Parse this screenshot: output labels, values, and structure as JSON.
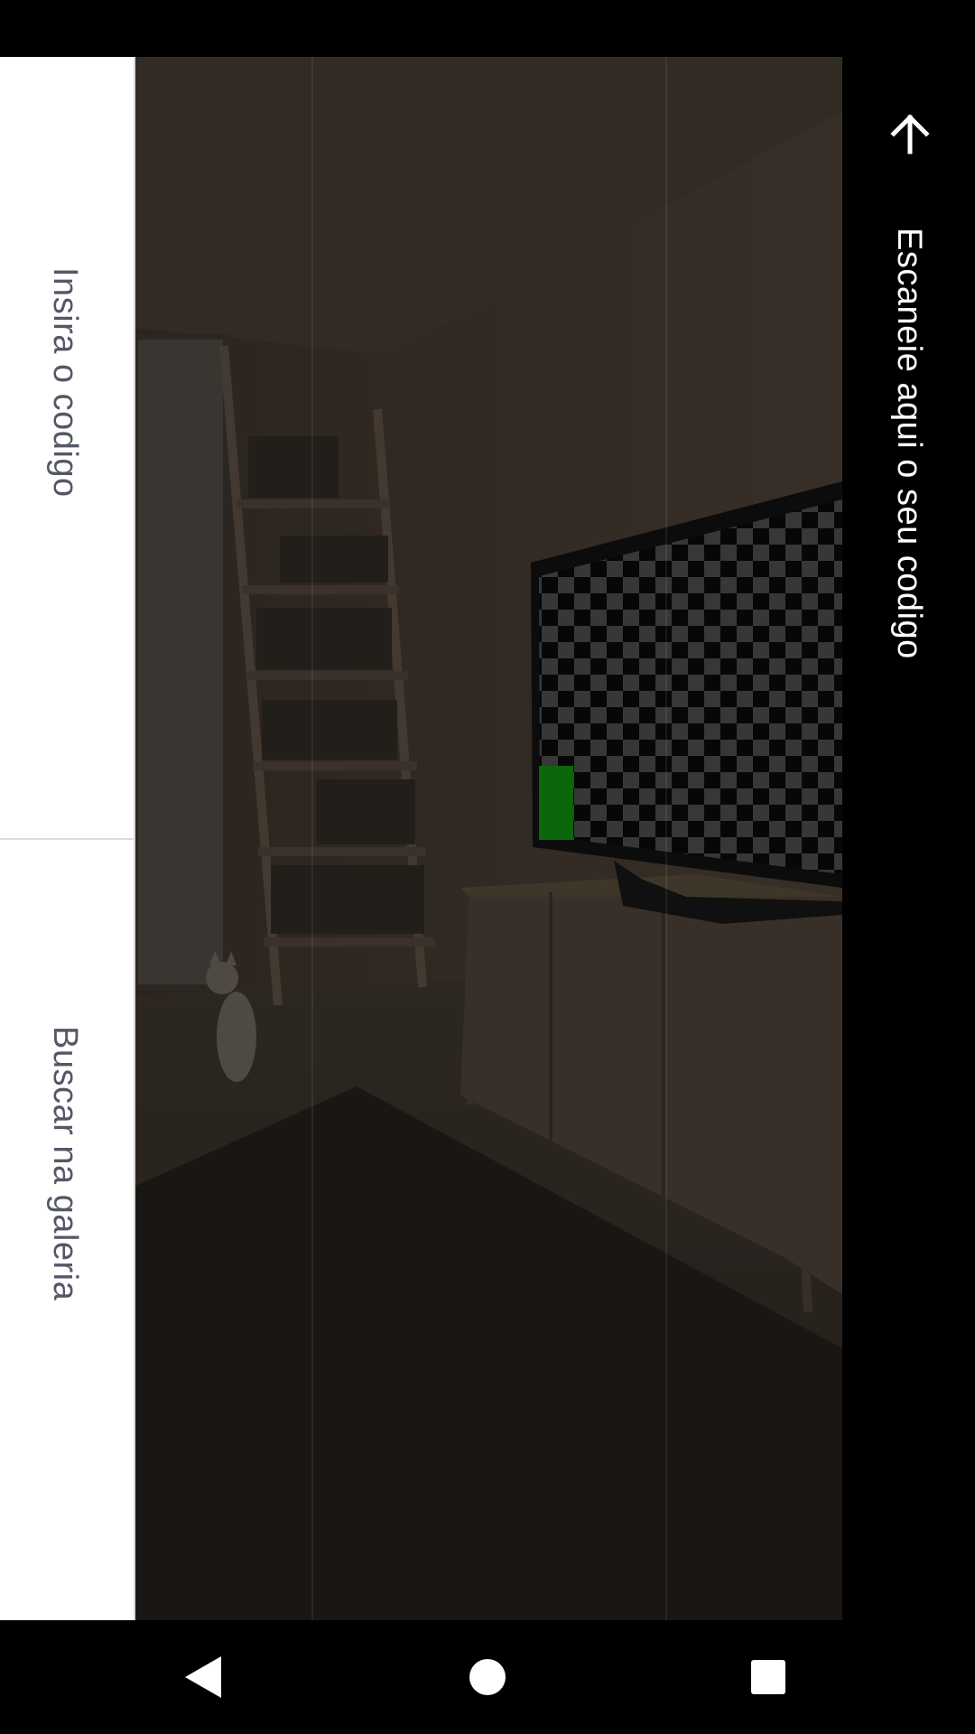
{
  "left_panel": {
    "enter_code_label": "Insira o codigo",
    "gallery_label": "Buscar na galeria"
  },
  "header": {
    "title": "Escaneie aqui o seu codigo",
    "back_icon": "arrow-up-icon"
  },
  "camera": {
    "preview_icon": "camera-viewfinder"
  },
  "nav_bar": {
    "back_icon": "triangle-back-icon",
    "home_icon": "circle-home-icon",
    "recents_icon": "square-recents-icon"
  },
  "colors": {
    "panel_bg": "#ffffff",
    "panel_text": "#545866",
    "chrome_bg": "#000000",
    "overlay_accent": "#0f8a0f"
  }
}
